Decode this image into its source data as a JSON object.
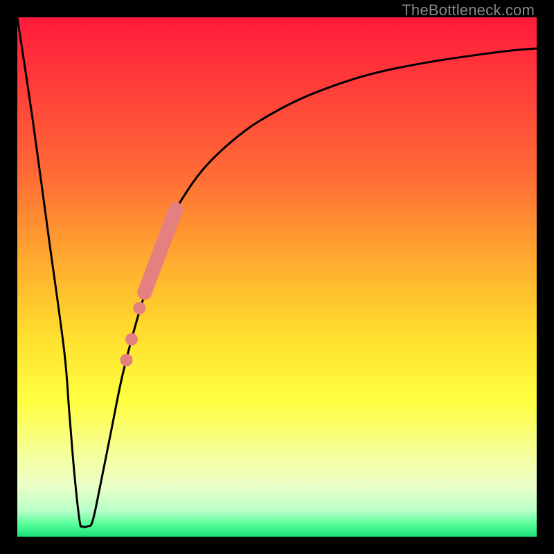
{
  "watermark": "TheBottleneck.com",
  "gradient": {
    "stops": [
      {
        "offset": 0.0,
        "color": "#ff1a3a"
      },
      {
        "offset": 0.12,
        "color": "#ff3a3a"
      },
      {
        "offset": 0.3,
        "color": "#ff6a35"
      },
      {
        "offset": 0.5,
        "color": "#ffb62e"
      },
      {
        "offset": 0.62,
        "color": "#ffe12e"
      },
      {
        "offset": 0.74,
        "color": "#ffff40"
      },
      {
        "offset": 0.84,
        "color": "#f5ff9a"
      },
      {
        "offset": 0.9,
        "color": "#ecffc8"
      },
      {
        "offset": 0.95,
        "color": "#b9ffc8"
      },
      {
        "offset": 0.975,
        "color": "#5aff9a"
      },
      {
        "offset": 1.0,
        "color": "#18e07a"
      }
    ]
  },
  "chart_data": {
    "type": "line",
    "title": "",
    "xlabel": "",
    "ylabel": "",
    "xlim": [
      0,
      100
    ],
    "ylim": [
      0,
      100
    ],
    "series": [
      {
        "name": "bottleneck-curve",
        "x": [
          0,
          3,
          6,
          9,
          10,
          11,
          12,
          12.5,
          13.5,
          14.5,
          16,
          18,
          20,
          22,
          24,
          26,
          28,
          30,
          33,
          36,
          40,
          45,
          50,
          55,
          60,
          66,
          72,
          80,
          88,
          96,
          100
        ],
        "y": [
          100,
          80,
          58,
          36,
          24,
          12,
          3,
          2,
          2,
          3,
          10,
          20,
          30,
          38,
          45,
          51,
          57,
          62,
          67,
          71,
          75,
          79,
          82,
          84.5,
          86.5,
          88.5,
          90,
          91.5,
          92.7,
          93.7,
          94
        ]
      }
    ],
    "highlight": {
      "name": "pink-segment",
      "color": "#e48080",
      "points": [
        {
          "x": 21.0,
          "y": 34.0,
          "r": 1.2
        },
        {
          "x": 22.0,
          "y": 38.0,
          "r": 1.2
        },
        {
          "x": 23.5,
          "y": 44.0,
          "r": 1.2
        }
      ],
      "thick_segment": {
        "x0": 24.5,
        "x1": 30.5,
        "y0": 47.0,
        "y1": 63.0,
        "width": 2.8
      }
    }
  }
}
